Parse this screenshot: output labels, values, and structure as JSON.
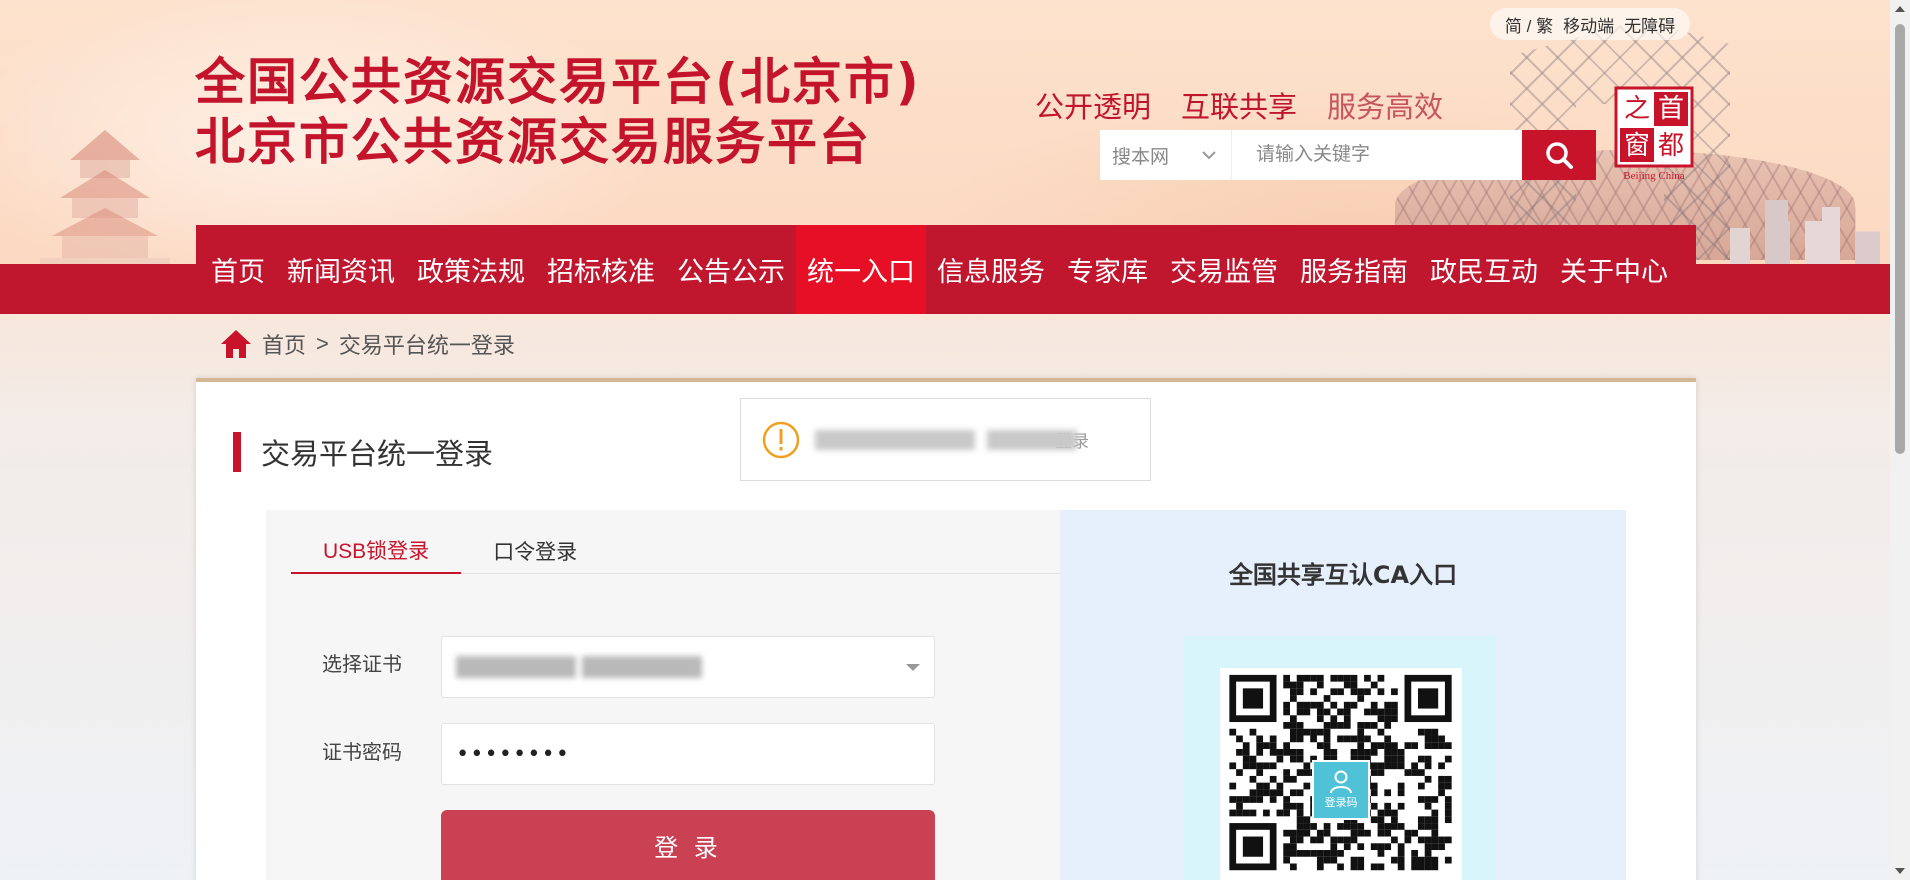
{
  "header": {
    "top_links": {
      "lang": "简 / 繁",
      "mobile": "移动端",
      "accessible": "无障碍"
    },
    "title_line1": "全国公共资源交易平台(北京市)",
    "title_line2": "北京市公共资源交易服务平台",
    "slogans": [
      "公开透明",
      "互联共享",
      "服务高效"
    ],
    "search": {
      "scope": "搜本网",
      "placeholder": "请输入关键字"
    },
    "logo": {
      "chars": [
        "首",
        "都",
        "之",
        "窗"
      ],
      "caption": "Beijing China"
    }
  },
  "nav": {
    "items": [
      "首页",
      "新闻资讯",
      "政策法规",
      "招标核准",
      "公告公示",
      "统一入口",
      "信息服务",
      "专家库",
      "交易监管",
      "服务指南",
      "政民互动",
      "关于中心"
    ],
    "active_index": 5
  },
  "breadcrumb": {
    "home": "首页",
    "separator": ">",
    "current": "交易平台统一登录"
  },
  "login": {
    "section_title": "交易平台统一登录",
    "toast_visible_text": "登录",
    "tabs": [
      "USB锁登录",
      "口令登录"
    ],
    "active_tab": 0,
    "cert_label": "选择证书",
    "password_label": "证书密码",
    "password_value": "••••••••",
    "submit_label": "登 录"
  },
  "ca": {
    "title": "全国共享互认CA入口",
    "qr_label": "登录码"
  },
  "colors": {
    "brand_red": "#c0172f",
    "active_nav": "#e60f25",
    "button": "#c94152",
    "ca_bg": "#e6f0fd"
  }
}
